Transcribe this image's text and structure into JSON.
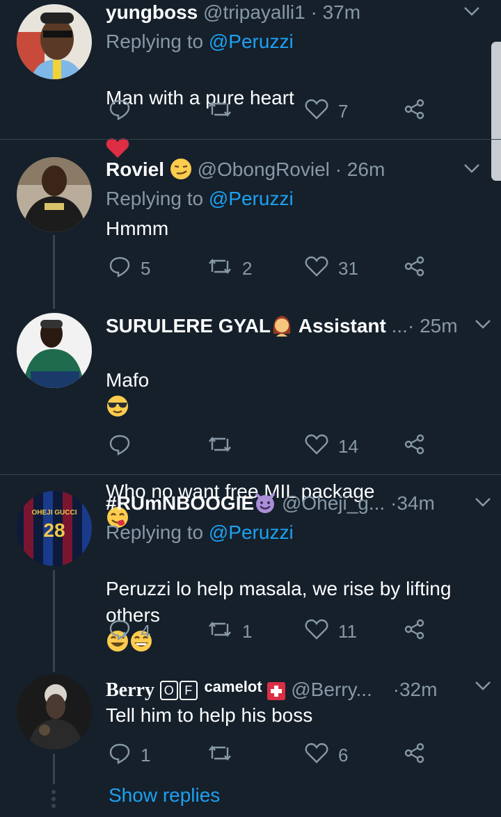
{
  "tweets": [
    {
      "name": "yungboss",
      "handle": "@tripayalli1",
      "sep": "·",
      "time": "37m",
      "replying_prefix": "Replying to",
      "replying_to": "@Peruzzi",
      "text": "Man with a pure heart",
      "reply_count": "",
      "retweet_count": "",
      "like_count": "7"
    },
    {
      "name": "Roviel",
      "handle": "@ObongRoviel",
      "sep": "·",
      "time": "26m",
      "replying_prefix": "Replying to",
      "replying_to": "@Peruzzi",
      "text": "Hmmm",
      "reply_count": "5",
      "retweet_count": "2",
      "like_count": "31"
    },
    {
      "name": "SURULERE GYAL",
      "name_suffix": "Assistant",
      "ellipsis": "...",
      "sep": "·",
      "time": "25m",
      "text_line1": "Mafo",
      "text_line2": "Who no want free MIL package",
      "reply_count": "",
      "retweet_count": "",
      "like_count": "14"
    },
    {
      "name": "#RUmNBOOGIE",
      "handle": "@Oheji_g...",
      "sep": "·",
      "time": "34m",
      "replying_prefix": "Replying to",
      "replying_to": "@Peruzzi",
      "text": "Peruzzi lo help masala, we rise by lifting others",
      "reply_count": "4",
      "retweet_count": "1",
      "like_count": "11",
      "avatar_jersey_name": "OHEJI GUCCI",
      "avatar_jersey_number": "28"
    },
    {
      "name": "Berry",
      "badge1": "O",
      "badge2": "F",
      "name_suffix": "camelot",
      "handle": "@Berry...",
      "sep": "·",
      "time": "32m",
      "text": "Tell him to help his boss",
      "reply_count": "1",
      "retweet_count": "",
      "like_count": "6"
    }
  ],
  "show_replies": "Show replies",
  "colors": {
    "background": "#15202b",
    "text_primary": "#ffffff",
    "text_secondary": "#8899a6",
    "link": "#1da1f2",
    "divider": "#38444d"
  }
}
